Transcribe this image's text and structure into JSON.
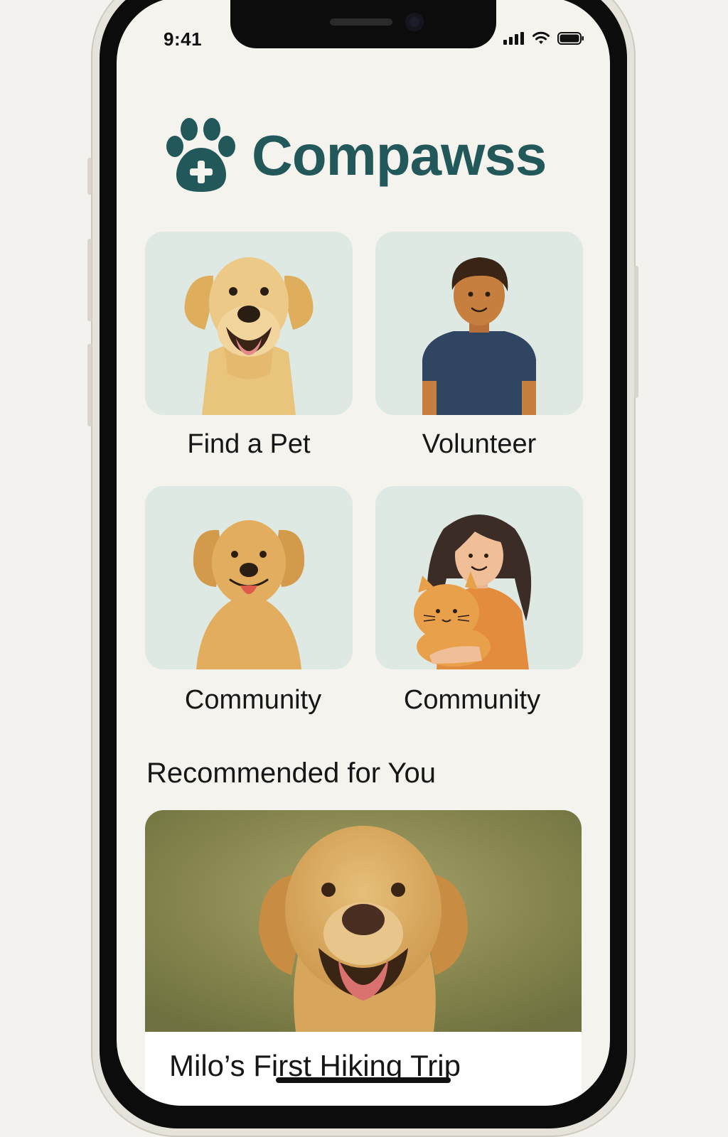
{
  "status_bar": {
    "time": "9:41",
    "icons": [
      "cellular-signal-icon",
      "wifi-icon",
      "battery-icon"
    ]
  },
  "app": {
    "name": "Compawss",
    "logo_icon": "paw-plus-icon",
    "brand_color": "#22585a"
  },
  "tiles": [
    {
      "label": "Find a Pet",
      "illustration": "golden-dog-illustration"
    },
    {
      "label": "Volunteer",
      "illustration": "volunteer-person-illustration"
    },
    {
      "label": "Community",
      "illustration": "sitting-dog-illustration"
    },
    {
      "label": "Community",
      "illustration": "woman-with-cat-illustration"
    }
  ],
  "recommended": {
    "section_title": "Recommended for You",
    "cards": [
      {
        "title": "Milo’s First Hiking Trip",
        "image": "golden-retriever-photo"
      }
    ]
  }
}
